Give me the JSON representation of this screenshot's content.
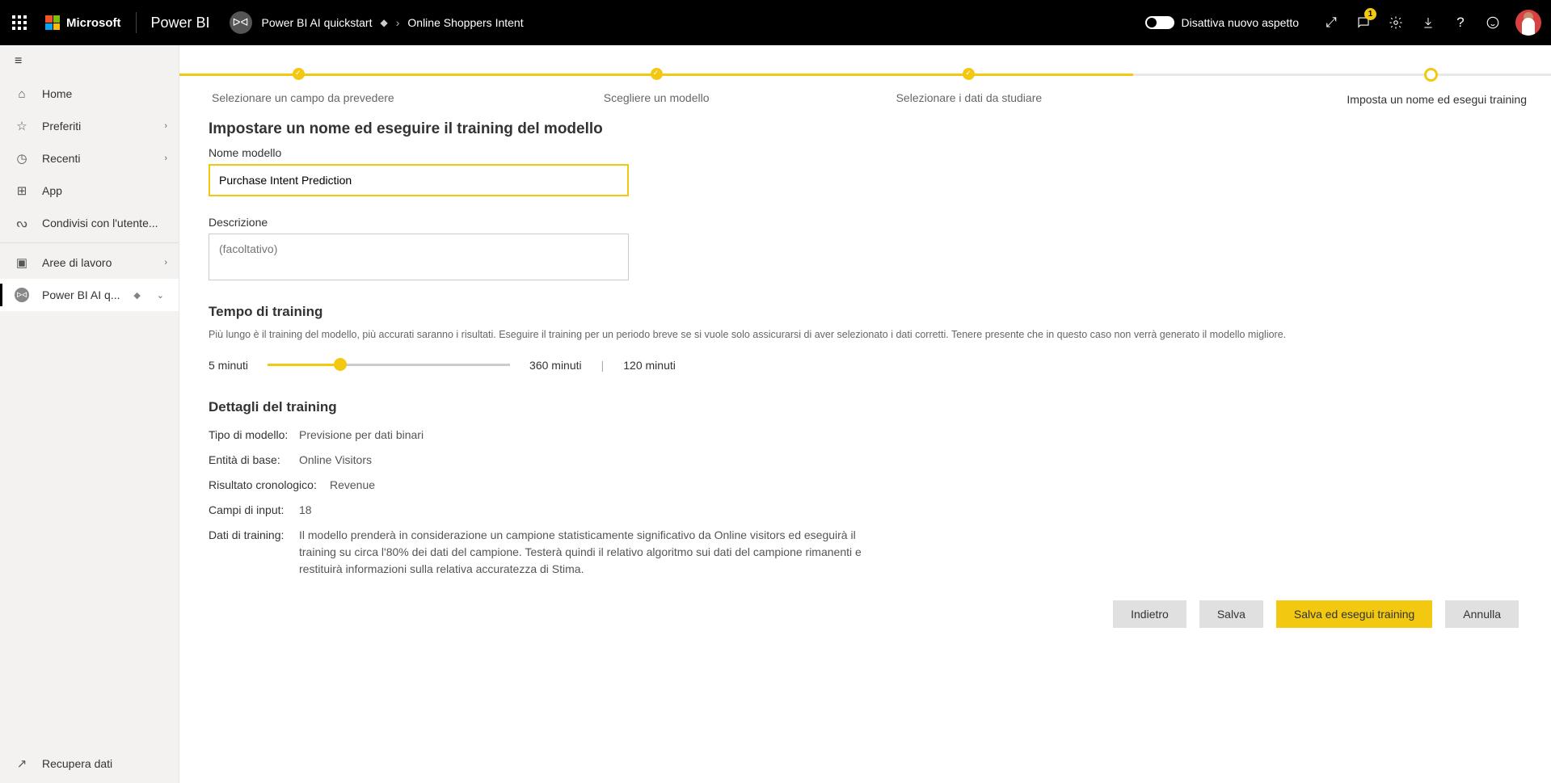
{
  "header": {
    "ms_label": "Microsoft",
    "product": "Power BI",
    "workspace_glyph": "ᐅᐊ",
    "breadcrumb_workspace": "Power BI AI quickstart",
    "breadcrumb_item": "Online Shoppers Intent",
    "toggle_label": "Disattiva nuovo aspetto",
    "notification_count": "1"
  },
  "sidebar": {
    "items": [
      {
        "icon": "⌂",
        "label": "Home",
        "chevron": false
      },
      {
        "icon": "☆",
        "label": "Preferiti",
        "chevron": true
      },
      {
        "icon": "◷",
        "label": "Recenti",
        "chevron": true
      },
      {
        "icon": "⊞",
        "label": "App",
        "chevron": false
      },
      {
        "icon": "ᔓ",
        "label": "Condivisi con l'utente...",
        "chevron": false
      }
    ],
    "workspaces_label": "Aree di lavoro",
    "active_workspace": "Power BI AI q...",
    "footer_label": "Recupera dati"
  },
  "wizard": {
    "steps": [
      "Selezionare un campo da prevedere",
      "Scegliere un modello",
      "Selezionare i dati da studiare",
      "Imposta un nome ed esegui training"
    ]
  },
  "form": {
    "title": "Impostare un nome ed eseguire il training del modello",
    "name_label": "Nome modello",
    "name_value": "Purchase Intent Prediction",
    "desc_label": "Descrizione",
    "desc_placeholder": "(facoltativo)",
    "time_label": "Tempo di training",
    "time_help": "Più lungo è il training del modello, più accurati saranno i risultati. Eseguire il training per un periodo breve se si vuole solo assicurarsi di aver selezionato i dati corretti. Tenere presente che in questo caso non verrà generato il modello migliore.",
    "slider_min": "5 minuti",
    "slider_max": "360 minuti",
    "slider_value": "120 minuti",
    "details_heading": "Dettagli del training",
    "details": [
      {
        "label": "Tipo di modello:",
        "value": "Previsione per dati binari"
      },
      {
        "label": "Entità di base:",
        "value": "Online Visitors"
      },
      {
        "label": "Risultato cronologico:",
        "value": "Revenue"
      },
      {
        "label": "Campi di input:",
        "value": "18"
      },
      {
        "label": "Dati di training:",
        "value": "Il modello prenderà in considerazione un campione statisticamente significativo da Online visitors ed eseguirà il training su circa l'80% dei dati del campione. Testerà quindi il relativo algoritmo sui dati del campione rimanenti e restituirà informazioni sulla relativa accuratezza di Stima."
      }
    ],
    "buttons": {
      "back": "Indietro",
      "save": "Salva",
      "train": "Salva ed esegui training",
      "cancel": "Annulla"
    }
  }
}
